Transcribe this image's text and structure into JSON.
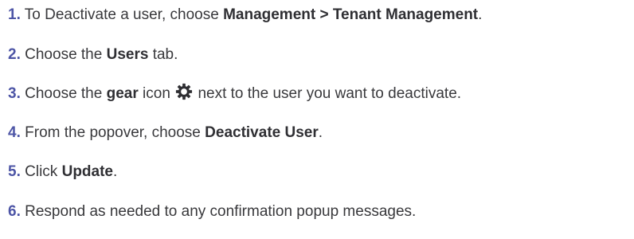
{
  "steps": [
    {
      "number": "1.",
      "segments": [
        {
          "text": "To Deactivate a user, choose ",
          "bold": false
        },
        {
          "text": "Management > Tenant Management",
          "bold": true
        },
        {
          "text": ".",
          "bold": false
        }
      ]
    },
    {
      "number": "2.",
      "segments": [
        {
          "text": "Choose the ",
          "bold": false
        },
        {
          "text": "Users",
          "bold": true
        },
        {
          "text": " tab.",
          "bold": false
        }
      ]
    },
    {
      "number": "3.",
      "segments": [
        {
          "text": "Choose the ",
          "bold": false
        },
        {
          "text": "gear",
          "bold": true
        },
        {
          "text": " icon ",
          "bold": false
        },
        {
          "icon": "gear-icon"
        },
        {
          "text": " next to the user you want to deactivate.",
          "bold": false
        }
      ]
    },
    {
      "number": "4.",
      "segments": [
        {
          "text": "From the popover, choose ",
          "bold": false
        },
        {
          "text": "Deactivate User",
          "bold": true
        },
        {
          "text": ".",
          "bold": false
        }
      ]
    },
    {
      "number": "5.",
      "segments": [
        {
          "text": "Click ",
          "bold": false
        },
        {
          "text": "Update",
          "bold": true
        },
        {
          "text": ".",
          "bold": false
        }
      ]
    },
    {
      "number": "6.",
      "segments": [
        {
          "text": "Respond as needed to any confirmation popup messages.",
          "bold": false
        }
      ]
    }
  ],
  "colors": {
    "step_number": "#4d55a6",
    "text": "#39393c"
  }
}
